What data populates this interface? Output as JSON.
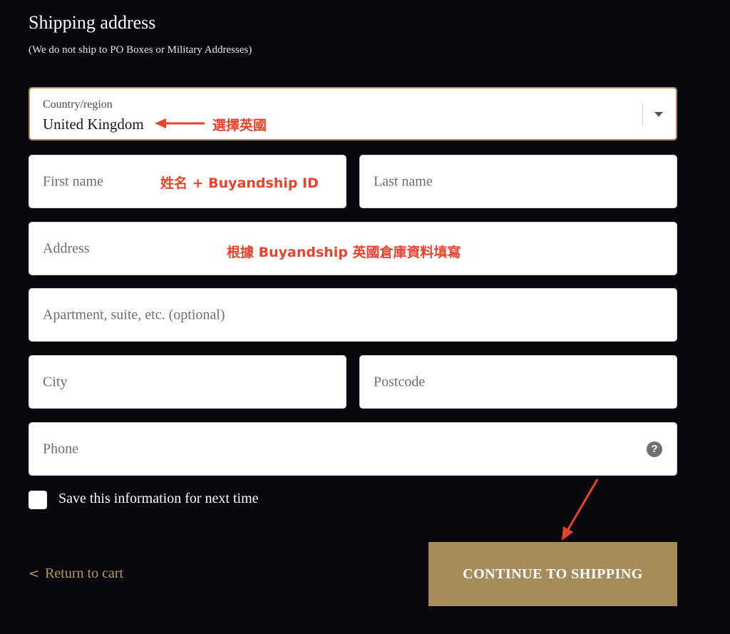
{
  "header": {
    "title": "Shipping address",
    "subtitle": "(We do not ship to PO Boxes or Military Addresses)"
  },
  "form": {
    "country_label": "Country/region",
    "country_value": "United Kingdom",
    "first_name_placeholder": "First name",
    "last_name_placeholder": "Last name",
    "address_placeholder": "Address",
    "apartment_placeholder": "Apartment, suite, etc. (optional)",
    "city_placeholder": "City",
    "postcode_placeholder": "Postcode",
    "phone_placeholder": "Phone",
    "help_glyph": "?",
    "save_info_label": "Save this information for next time",
    "save_info_checked": false
  },
  "footer": {
    "back_chevron": "<",
    "return_label": "Return to cart",
    "continue_label": "CONTINUE TO SHIPPING"
  },
  "annotations": {
    "country_note": "選擇英國",
    "name_note": "姓名 + Buyandship ID",
    "address_note": "根據 Buyandship 英國倉庫資料填寫"
  },
  "colors": {
    "background": "#07070d",
    "accent_gold": "#a78c5b",
    "annotation_red": "#e8442d"
  }
}
